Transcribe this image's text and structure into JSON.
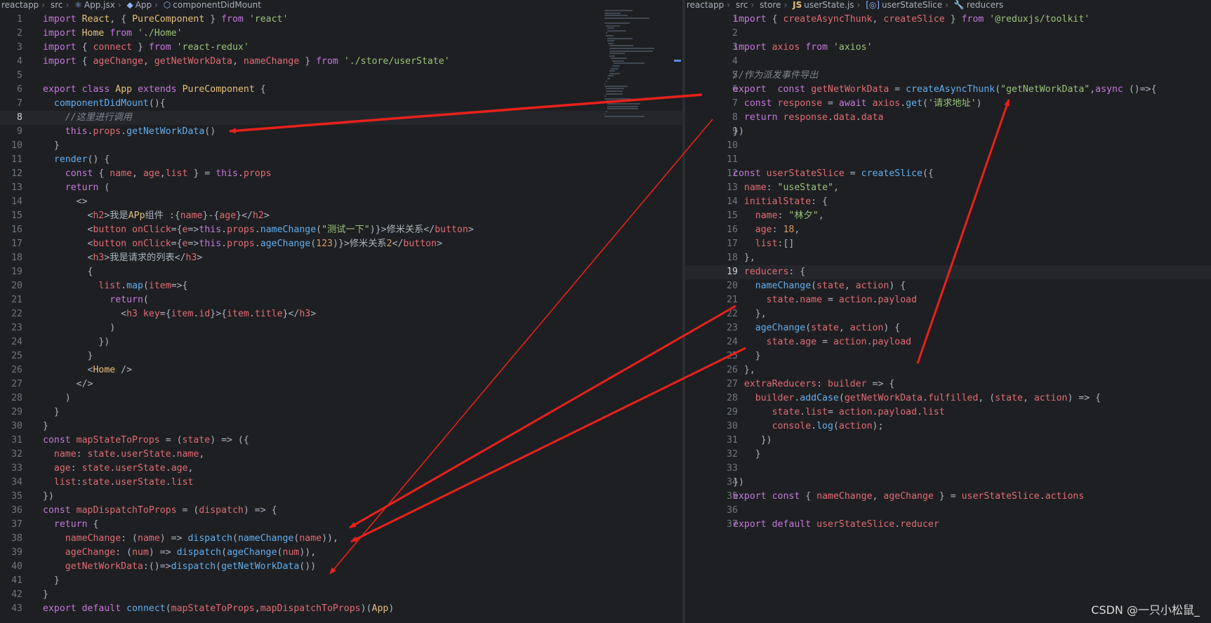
{
  "left_breadcrumb": [
    "reactapp",
    "src",
    "App.jsx",
    "App",
    "componentDidMount"
  ],
  "right_breadcrumb": [
    "reactapp",
    "src",
    "store",
    "userState.js",
    "userStateSlice",
    "reducers"
  ],
  "left_file": {
    "active_line": 8,
    "lines": [
      "import React, { PureComponent } from 'react'",
      "import Home from './Home'",
      "import { connect } from 'react-redux'",
      "import { ageChange, getNetWorkData, nameChange } from './store/userState'",
      "",
      "export class App extends PureComponent {",
      "  componentDidMount(){",
      "    //这里进行调用",
      "    this.props.getNetWorkData()",
      "  }",
      "  render() {",
      "    const { name, age,list } = this.props",
      "    return (",
      "      <>",
      "        <h2>我是APp组件 :{name}-{age}</h2>",
      "        <button onClick={e=>this.props.nameChange(\"测试一下\")}>修米关系</button>",
      "        <button onClick={e=>this.props.ageChange(123)}>修米关系2</button>",
      "        <h3>我是请求的列表</h3>",
      "        {",
      "          list.map(item=>{",
      "            return(",
      "              <h3 key={item.id}>{item.title}</h3>",
      "            )",
      "          })",
      "        }",
      "        <Home />",
      "      </>",
      "    )",
      "  }",
      "}",
      "const mapStateToProps = (state) => ({",
      "  name: state.userState.name,",
      "  age: state.userState.age,",
      "  list:state.userState.list",
      "})",
      "const mapDispatchToProps = (dispatch) => {",
      "  return {",
      "    nameChange: (name) => dispatch(nameChange(name)),",
      "    ageChange: (num) => dispatch(ageChange(num)),",
      "    getNetWorkData:()=>dispatch(getNetWorkData())",
      "  }",
      "}",
      "export default connect(mapStateToProps,mapDispatchToProps)(App)"
    ]
  },
  "right_file": {
    "active_line": 19,
    "lines": [
      "import { createAsyncThunk, createSlice } from '@reduxjs/toolkit'",
      "",
      "import axios from 'axios'",
      "",
      "//作为派发事件导出",
      "export  const getNetWorkData = createAsyncThunk(\"getNetWorkData\",async ()=>{",
      "  const response = await axios.get('请求地址')",
      "  return response.data.data",
      "})",
      "",
      "",
      "const userStateSlice = createSlice({",
      "  name: \"useState\",",
      "  initialState: {",
      "    name: \"林夕\",",
      "    age: 18,",
      "    list:[]",
      "  },",
      "  reducers: {",
      "    nameChange(state, action) {",
      "      state.name = action.payload",
      "    },",
      "    ageChange(state, action) {",
      "      state.age = action.payload",
      "    }",
      "  },",
      "  extraReducers: builder => {",
      "    builder.addCase(getNetWorkData.fulfilled, (state, action) => {",
      "       state.list= action.payload.list",
      "       console.log(action);",
      "     })",
      "    }",
      "",
      "})",
      "export const { nameChange, ageChange } = userStateSlice.actions",
      "",
      "export default userStateSlice.reducer"
    ]
  },
  "watermark": "CSDN @一只小松鼠_",
  "colors": {
    "background": "#1e1f22",
    "keyword": "#c678dd",
    "function": "#61afef",
    "string": "#98c379",
    "comment": "#7f848e",
    "arrow": "#e8211b"
  }
}
